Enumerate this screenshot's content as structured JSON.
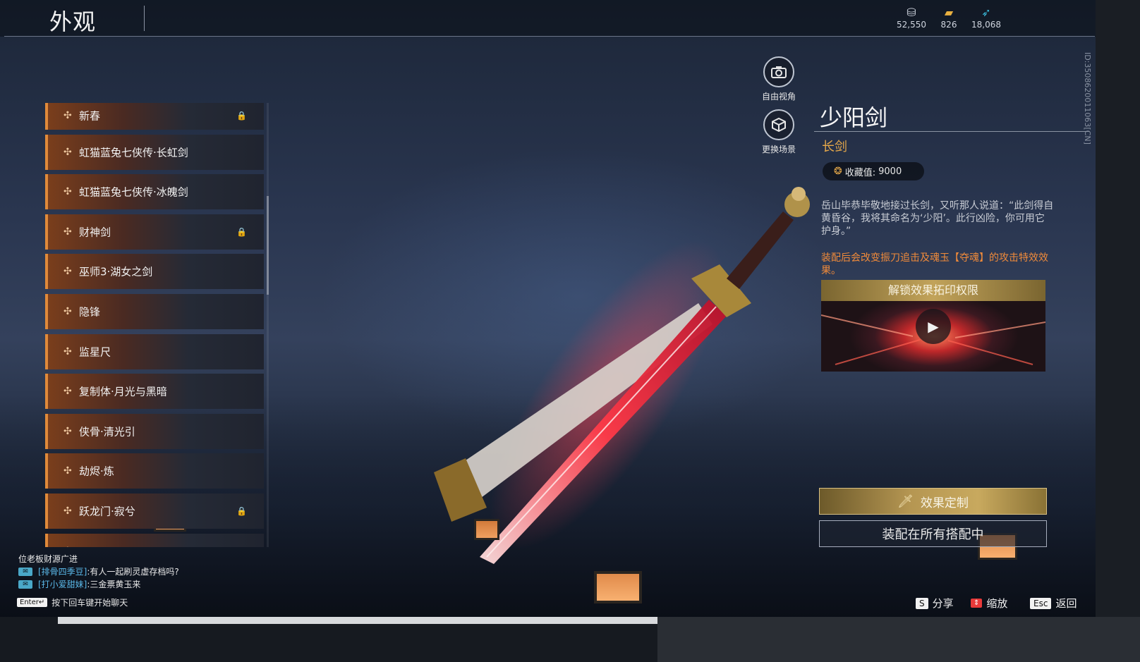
{
  "header": {
    "title": "外观",
    "currencies": [
      {
        "icon": "coin-icon",
        "value": "52,550"
      },
      {
        "icon": "ticket-icon",
        "value": "826"
      },
      {
        "icon": "feather-icon",
        "value": "18,068"
      }
    ],
    "side_id": "ID:3508620011063[CN]"
  },
  "camera": {
    "free_view_label": "自由视角",
    "change_scene_label": "更换场景"
  },
  "list": {
    "items": [
      {
        "label": "新春",
        "locked": true
      },
      {
        "label": "虹猫蓝兔七侠传·长虹剑",
        "locked": false
      },
      {
        "label": "虹猫蓝兔七侠传·冰魄剑",
        "locked": false
      },
      {
        "label": "财神剑",
        "locked": true
      },
      {
        "label": "巫师3·湖女之剑",
        "locked": false
      },
      {
        "label": "隐锋",
        "locked": false
      },
      {
        "label": "监星尺",
        "locked": false
      },
      {
        "label": "复制体·月光与黑暗",
        "locked": false
      },
      {
        "label": "侠骨·清光引",
        "locked": false
      },
      {
        "label": "劫烬·炼",
        "locked": false
      },
      {
        "label": "跃龙门·寂兮",
        "locked": true
      }
    ]
  },
  "detail": {
    "name": "少阳剑",
    "type": "长剑",
    "collect_label": "收藏值:",
    "collect_value": "9000",
    "description": "岳山毕恭毕敬地接过长剑，又听那人说道：“此剑得自黄昏谷，我将其命名为‘少阳’。此行凶险，你可用它护身。”",
    "effect_text": "装配后会改变振刀追击及魂玉【夺魂】的攻击特效效果。",
    "unlock_title": "解锁效果拓印权限",
    "customize_label": "效果定制",
    "equip_label": "装配在所有搭配中"
  },
  "chat": {
    "header": "位老板财源广进",
    "messages": [
      {
        "user": "[排骨四季豆]",
        "text": ":有人一起刷灵虚存档吗?"
      },
      {
        "user": "[打小爱甜妹]",
        "text": ":三金票黄玉来"
      }
    ],
    "input_key": "Enter↵",
    "input_hint": "按下回车键开始聊天"
  },
  "hints": [
    {
      "key": "S",
      "label": "分享"
    },
    {
      "key": "⇕",
      "label": "缩放"
    },
    {
      "key": "Esc",
      "label": "返回"
    }
  ],
  "colors": {
    "accent_orange": "#e08a3a",
    "gold": "#c8a95e",
    "type_gold": "#e5a84a",
    "chat_user": "#5ab8e8"
  }
}
